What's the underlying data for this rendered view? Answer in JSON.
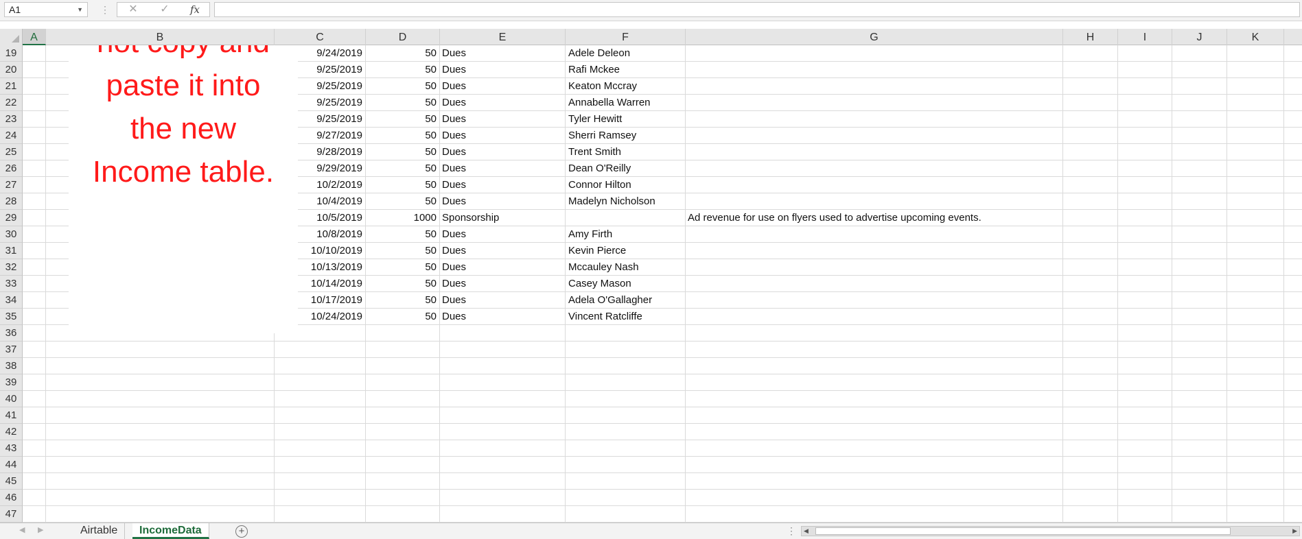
{
  "formula_bar": {
    "name_box": "A1",
    "cancel_icon": "cancel-icon",
    "enter_icon": "checkmark-icon",
    "function_label": "fx",
    "formula": ""
  },
  "columns": [
    {
      "label": "A",
      "selected": true
    },
    {
      "label": "B"
    },
    {
      "label": "C"
    },
    {
      "label": "D"
    },
    {
      "label": "E"
    },
    {
      "label": "F"
    },
    {
      "label": "G"
    },
    {
      "label": "H"
    },
    {
      "label": "I"
    },
    {
      "label": "J"
    },
    {
      "label": "K"
    }
  ],
  "row_numbers": [
    "19",
    "20",
    "21",
    "22",
    "23",
    "24",
    "25",
    "26",
    "27",
    "28",
    "29",
    "30",
    "31",
    "32",
    "33",
    "34",
    "35",
    "36",
    "37",
    "38",
    "39",
    "40",
    "41",
    "42",
    "43",
    "44",
    "45",
    "46",
    "47"
  ],
  "rows": [
    {
      "date": "9/24/2019",
      "amount": "50",
      "type": "Dues",
      "name": "Adele Deleon",
      "note": ""
    },
    {
      "date": "9/25/2019",
      "amount": "50",
      "type": "Dues",
      "name": "Rafi Mckee",
      "note": ""
    },
    {
      "date": "9/25/2019",
      "amount": "50",
      "type": "Dues",
      "name": "Keaton Mccray",
      "note": ""
    },
    {
      "date": "9/25/2019",
      "amount": "50",
      "type": "Dues",
      "name": "Annabella Warren",
      "note": ""
    },
    {
      "date": "9/25/2019",
      "amount": "50",
      "type": "Dues",
      "name": "Tyler Hewitt",
      "note": ""
    },
    {
      "date": "9/27/2019",
      "amount": "50",
      "type": "Dues",
      "name": "Sherri Ramsey",
      "note": ""
    },
    {
      "date": "9/28/2019",
      "amount": "50",
      "type": "Dues",
      "name": "Trent Smith",
      "note": ""
    },
    {
      "date": "9/29/2019",
      "amount": "50",
      "type": "Dues",
      "name": "Dean O'Reilly",
      "note": ""
    },
    {
      "date": "10/2/2019",
      "amount": "50",
      "type": "Dues",
      "name": "Connor Hilton",
      "note": ""
    },
    {
      "date": "10/4/2019",
      "amount": "50",
      "type": "Dues",
      "name": "Madelyn Nicholson",
      "note": ""
    },
    {
      "date": "10/5/2019",
      "amount": "1000",
      "type": "Sponsorship",
      "name": "",
      "note": "Ad revenue for use on flyers used to advertise upcoming events."
    },
    {
      "date": "10/8/2019",
      "amount": "50",
      "type": "Dues",
      "name": "Amy Firth",
      "note": ""
    },
    {
      "date": "10/10/2019",
      "amount": "50",
      "type": "Dues",
      "name": "Kevin Pierce",
      "note": ""
    },
    {
      "date": "10/13/2019",
      "amount": "50",
      "type": "Dues",
      "name": "Mccauley Nash",
      "note": ""
    },
    {
      "date": "10/14/2019",
      "amount": "50",
      "type": "Dues",
      "name": "Casey Mason",
      "note": ""
    },
    {
      "date": "10/17/2019",
      "amount": "50",
      "type": "Dues",
      "name": "Adela O'Gallagher",
      "note": ""
    },
    {
      "date": "10/24/2019",
      "amount": "50",
      "type": "Dues",
      "name": "Vincent Ratcliffe",
      "note": ""
    }
  ],
  "textbox": {
    "text": "not copy and\npaste it into\nthe new\nIncome table.",
    "color": "#ff1a1a"
  },
  "sheet_tabs": [
    {
      "label": "Airtable",
      "active": false
    },
    {
      "label": "IncomeData",
      "active": true
    }
  ],
  "add_sheet_icon": "plus-circle-icon",
  "accent_color": "#217346"
}
